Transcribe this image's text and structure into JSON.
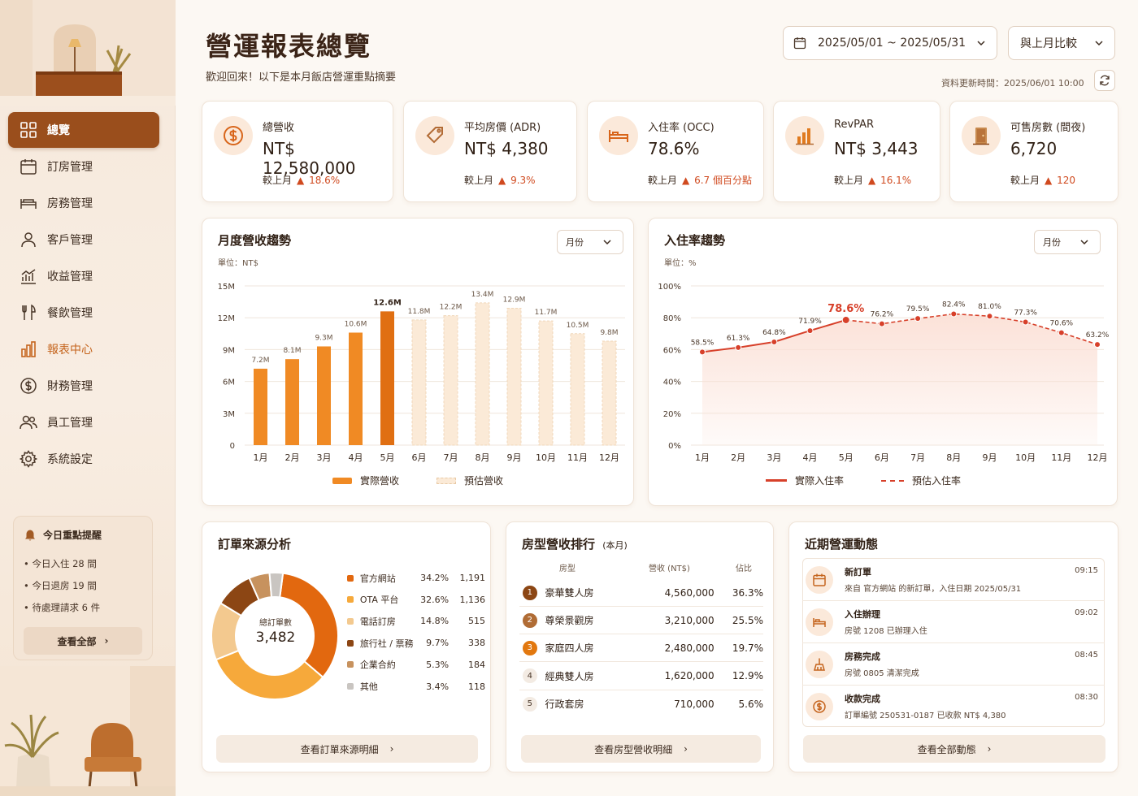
{
  "sidebar": {
    "items": [
      {
        "label": "總覽",
        "icon": "grid-icon"
      },
      {
        "label": "訂房管理",
        "icon": "calendar-icon"
      },
      {
        "label": "房務管理",
        "icon": "bed-icon"
      },
      {
        "label": "客戶管理",
        "icon": "user-icon"
      },
      {
        "label": "收益管理",
        "icon": "trend-chart-icon"
      },
      {
        "label": "餐飲管理",
        "icon": "fork-knife-icon"
      },
      {
        "label": "報表中心",
        "icon": "bar-chart-icon"
      },
      {
        "label": "財務管理",
        "icon": "dollar-circle-icon"
      },
      {
        "label": "員工管理",
        "icon": "users-icon"
      },
      {
        "label": "系統設定",
        "icon": "gear-icon"
      }
    ],
    "active": "總覽",
    "reminder": {
      "title": "今日重點提醒",
      "lines": [
        "• 今日入住 28 間",
        "• 今日退房 19 間",
        "• 待處理請求 6 件"
      ],
      "button": "查看全部"
    }
  },
  "header": {
    "title": "營運報表總覽",
    "subtitle": "歡迎回來！以下是本月飯店營運重點摘要",
    "date_range": "2025/05/01 ~ 2025/05/31",
    "compare": "與上月比較",
    "updated": "資料更新時間：2025/06/01 10:00"
  },
  "kpis": [
    {
      "label": "總營收",
      "value": "NT$ 12,580,000",
      "cmp_label": "較上月",
      "delta": "18.6%",
      "icon": "dollar-icon"
    },
    {
      "label": "平均房價 (ADR)",
      "value": "NT$ 4,380",
      "cmp_label": "較上月",
      "delta": "9.3%",
      "icon": "tag-icon"
    },
    {
      "label": "入住率 (OCC)",
      "value": "78.6%",
      "cmp_label": "較上月",
      "delta": "6.7 個百分點",
      "icon": "bed-icon"
    },
    {
      "label": "RevPAR",
      "value": "NT$ 3,443",
      "cmp_label": "較上月",
      "delta": "16.1%",
      "icon": "bar-chart-icon"
    },
    {
      "label": "可售房數 (間夜)",
      "value": "6,720",
      "cmp_label": "較上月",
      "delta": "120",
      "icon": "door-icon"
    }
  ],
  "revenue_panel": {
    "title": "月度營收趨勢",
    "unit": "單位：NT$",
    "select": "月份"
  },
  "occ_panel": {
    "title": "入住率趨勢",
    "unit": "單位：%",
    "select": "月份"
  },
  "chart_data": [
    {
      "type": "bar",
      "title": "月度營收趨勢",
      "categories": [
        "1月",
        "2月",
        "3月",
        "4月",
        "5月",
        "6月",
        "7月",
        "8月",
        "9月",
        "10月",
        "11月",
        "12月"
      ],
      "series": [
        {
          "name": "實際營收",
          "values": [
            7.2,
            8.1,
            9.3,
            10.6,
            12.6,
            null,
            null,
            null,
            null,
            null,
            null,
            null
          ]
        },
        {
          "name": "預估營收",
          "values": [
            null,
            null,
            null,
            null,
            null,
            11.8,
            12.2,
            13.4,
            12.9,
            11.7,
            10.5,
            9.8
          ]
        }
      ],
      "data_labels": [
        "7.2M",
        "8.1M",
        "9.3M",
        "10.6M",
        "12.6M",
        "11.8M",
        "12.2M",
        "13.4M",
        "12.9M",
        "11.7M",
        "10.5M",
        "9.8M"
      ],
      "ylim": [
        0,
        15
      ],
      "yticks": [
        "0",
        "3M",
        "6M",
        "9M",
        "12M",
        "15M"
      ],
      "colors": {
        "actual": "#f08a24",
        "highlight": "#e06f12",
        "forecast": "#fbead7"
      },
      "grid": true,
      "legend": "bottom"
    },
    {
      "type": "line",
      "title": "入住率趨勢",
      "categories": [
        "1月",
        "2月",
        "3月",
        "4月",
        "5月",
        "6月",
        "7月",
        "8月",
        "9月",
        "10月",
        "11月",
        "12月"
      ],
      "series": [
        {
          "name": "實際入住率",
          "values": [
            58.5,
            61.3,
            64.8,
            71.9,
            78.6,
            null,
            null,
            null,
            null,
            null,
            null,
            null
          ]
        },
        {
          "name": "預估入住率",
          "values": [
            null,
            null,
            null,
            null,
            78.6,
            76.2,
            79.5,
            82.4,
            81.0,
            77.3,
            70.6,
            63.2
          ]
        }
      ],
      "data_labels": [
        "58.5%",
        "61.3%",
        "64.8%",
        "71.9%",
        "78.6%",
        "76.2%",
        "79.5%",
        "82.4%",
        "81.0%",
        "77.3%",
        "70.6%",
        "63.2%"
      ],
      "ylim": [
        0,
        100
      ],
      "yticks": [
        "0%",
        "20%",
        "40%",
        "60%",
        "80%",
        "100%"
      ],
      "colors": {
        "line": "#d7402a",
        "fill": "#fbe0d6"
      },
      "grid": true,
      "legend": "bottom"
    },
    {
      "type": "pie",
      "title": "訂單來源分析",
      "center_label": "總訂單數",
      "center_value": "3,482",
      "slices": [
        {
          "name": "官方網站",
          "pct": "34.2%",
          "value": 1191,
          "count": "1,191",
          "color": "#e2680f"
        },
        {
          "name": "OTA 平台",
          "pct": "32.6%",
          "value": 1136,
          "count": "1,136",
          "color": "#f6a93b"
        },
        {
          "name": "電話訂房",
          "pct": "14.8%",
          "value": 515,
          "count": "515",
          "color": "#f3c98f"
        },
        {
          "name": "旅行社 / 票務",
          "pct": "9.7%",
          "value": 338,
          "count": "338",
          "color": "#8c4614"
        },
        {
          "name": "企業合約",
          "pct": "5.3%",
          "value": 184,
          "count": "184",
          "color": "#c7925e"
        },
        {
          "name": "其他",
          "pct": "3.4%",
          "value": 118,
          "count": "118",
          "color": "#c9c5c1"
        }
      ]
    }
  ],
  "source_panel": {
    "title": "訂單來源分析",
    "button": "查看訂單來源明細"
  },
  "ranking": {
    "title": "房型營收排行",
    "subtitle": "(本月)",
    "headers": [
      "房型",
      "營收 (NT$)",
      "佔比"
    ],
    "rows": [
      {
        "rank": "1",
        "name": "豪華雙人房",
        "revenue": "4,560,000",
        "pct": "36.3%",
        "color": "#8c4614"
      },
      {
        "rank": "2",
        "name": "尊榮景觀房",
        "revenue": "3,210,000",
        "pct": "25.5%",
        "color": "#b06c35"
      },
      {
        "rank": "3",
        "name": "家庭四人房",
        "revenue": "2,480,000",
        "pct": "19.7%",
        "color": "#e2780f"
      },
      {
        "rank": "4",
        "name": "經典雙人房",
        "revenue": "1,620,000",
        "pct": "12.9%",
        "color": ""
      },
      {
        "rank": "5",
        "name": "行政套房",
        "revenue": "710,000",
        "pct": "5.6%",
        "color": ""
      }
    ],
    "button": "查看房型營收明細"
  },
  "activity": {
    "title": "近期營運動態",
    "items": [
      {
        "title": "新訂單",
        "desc": "來自 官方網站 的新訂單，入住日期 2025/05/31",
        "time": "09:15",
        "icon": "calendar-icon"
      },
      {
        "title": "入住辦理",
        "desc": "房號 1208 已辦理入住",
        "time": "09:02",
        "icon": "bed-icon"
      },
      {
        "title": "房務完成",
        "desc": "房號 0805 清潔完成",
        "time": "08:45",
        "icon": "broom-icon"
      },
      {
        "title": "收款完成",
        "desc": "訂單編號 250531-0187 已收款 NT$ 4,380",
        "time": "08:30",
        "icon": "dollar-icon"
      }
    ],
    "button": "查看全部動態"
  }
}
